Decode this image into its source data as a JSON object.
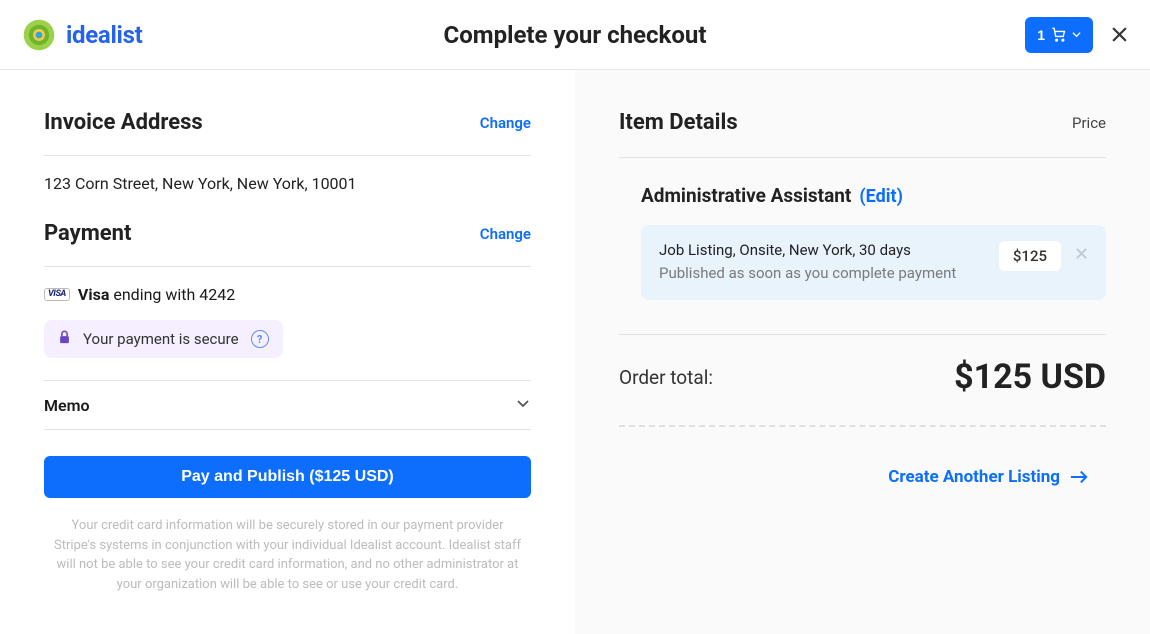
{
  "brand": {
    "name": "idealist"
  },
  "header": {
    "title": "Complete your checkout",
    "cart_count": "1"
  },
  "left": {
    "invoice_title": "Invoice Address",
    "change_label": "Change",
    "address": "123 Corn Street, New York, New York, 10001",
    "payment_title": "Payment",
    "card_brand": "Visa",
    "card_text": "ending with 4242",
    "visa_badge": "VISA",
    "secure_text": "Your payment is secure",
    "memo_label": "Memo",
    "pay_label": "Pay and Publish ($125 USD)",
    "disclaimer": "Your credit card information will be securely stored in our payment provider Stripe's systems in conjunction with your individual Idealist account. Idealist staff will not be able to see your credit card information, and no other administrator at your organization will be able to see or use your credit card."
  },
  "right": {
    "details_title": "Item Details",
    "price_label": "Price",
    "item_name": "Administrative Assistant",
    "edit_label": "(Edit)",
    "item_meta": "Job Listing, Onsite, New York, 30 days",
    "item_note": "Published as soon as you complete payment",
    "item_price": "$125",
    "order_total_label": "Order total:",
    "order_total": "$125 USD",
    "create_another": "Create Another Listing"
  }
}
